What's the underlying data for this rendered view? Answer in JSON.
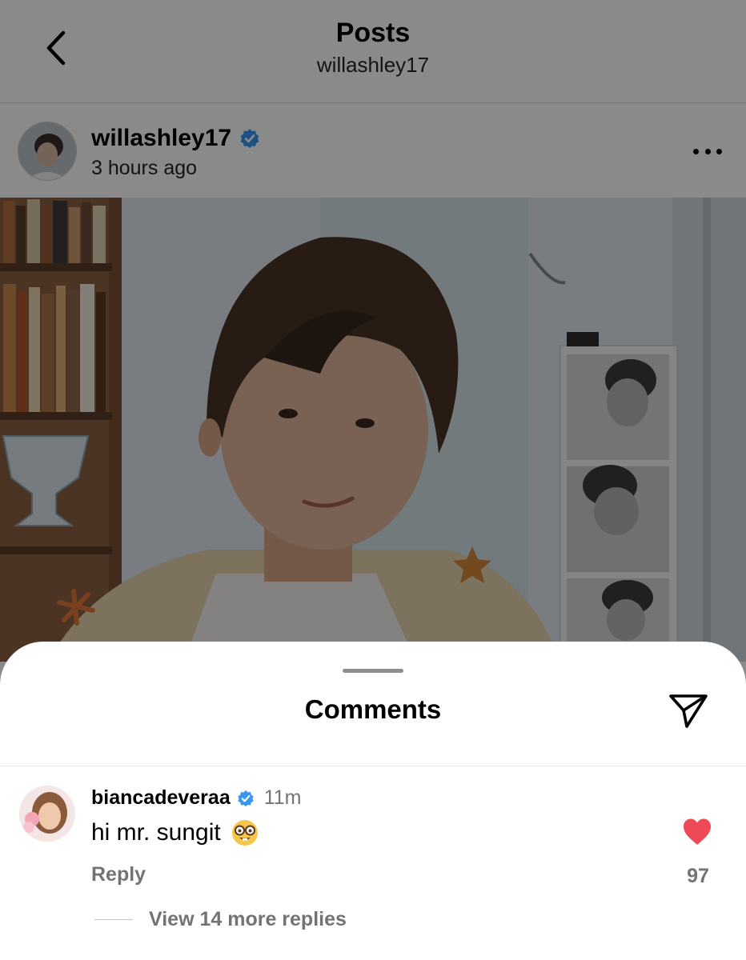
{
  "header": {
    "title": "Posts",
    "subtitle": "willashley17"
  },
  "post": {
    "username": "willashley17",
    "verified": true,
    "time": "3 hours ago"
  },
  "comments_sheet": {
    "title": "Comments",
    "comments": [
      {
        "username": "biancadeveraa",
        "verified": true,
        "time": "11m",
        "text": "hi mr. sungit",
        "emoji": "nerd-face",
        "reply_label": "Reply",
        "likes": "97",
        "liked": true,
        "view_replies_label": "View 14 more replies"
      }
    ]
  },
  "colors": {
    "verified_blue": "#3897f0",
    "like_red": "#ed4956",
    "secondary_text": "#737373"
  }
}
